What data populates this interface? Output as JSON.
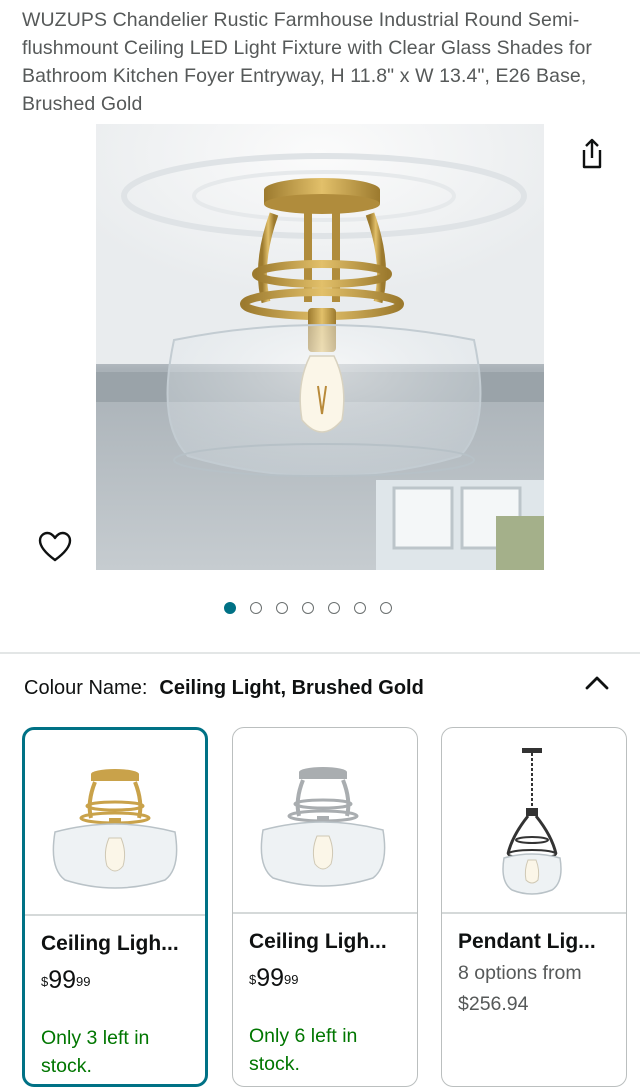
{
  "product": {
    "title": "WUZUPS Chandelier Rustic Farmhouse Industrial Round Semi-flushmount Ceiling LED Light Fixture with Clear Glass Shades for Bathroom Kitchen Foyer Entryway, H 11.8\" x W 13.4\", E26 Base, Brushed Gold"
  },
  "gallery": {
    "image_count": 7,
    "active_index": 0
  },
  "icons": {
    "share": "share-icon",
    "wishlist": "heart-icon",
    "collapse": "chevron-up-icon"
  },
  "variation": {
    "label": "Colour Name:",
    "selected_value": "Ceiling Light, Brushed Gold"
  },
  "options": [
    {
      "name": "Ceiling Ligh...",
      "price": {
        "currency": "$",
        "whole": "99",
        "fraction": "99"
      },
      "stock": "Only 3 left in stock.",
      "selected": true
    },
    {
      "name": "Ceiling Ligh...",
      "price": {
        "currency": "$",
        "whole": "99",
        "fraction": "99"
      },
      "stock": "Only 6 left in stock.",
      "selected": false
    },
    {
      "name": "Pendant Lig...",
      "options_text": "8 options from $256.94",
      "selected": false
    }
  ],
  "colors": {
    "accent": "#007185",
    "stock_green": "#007600",
    "gold": "#c9a24a",
    "brushed_nickel": "#a9adb0"
  }
}
